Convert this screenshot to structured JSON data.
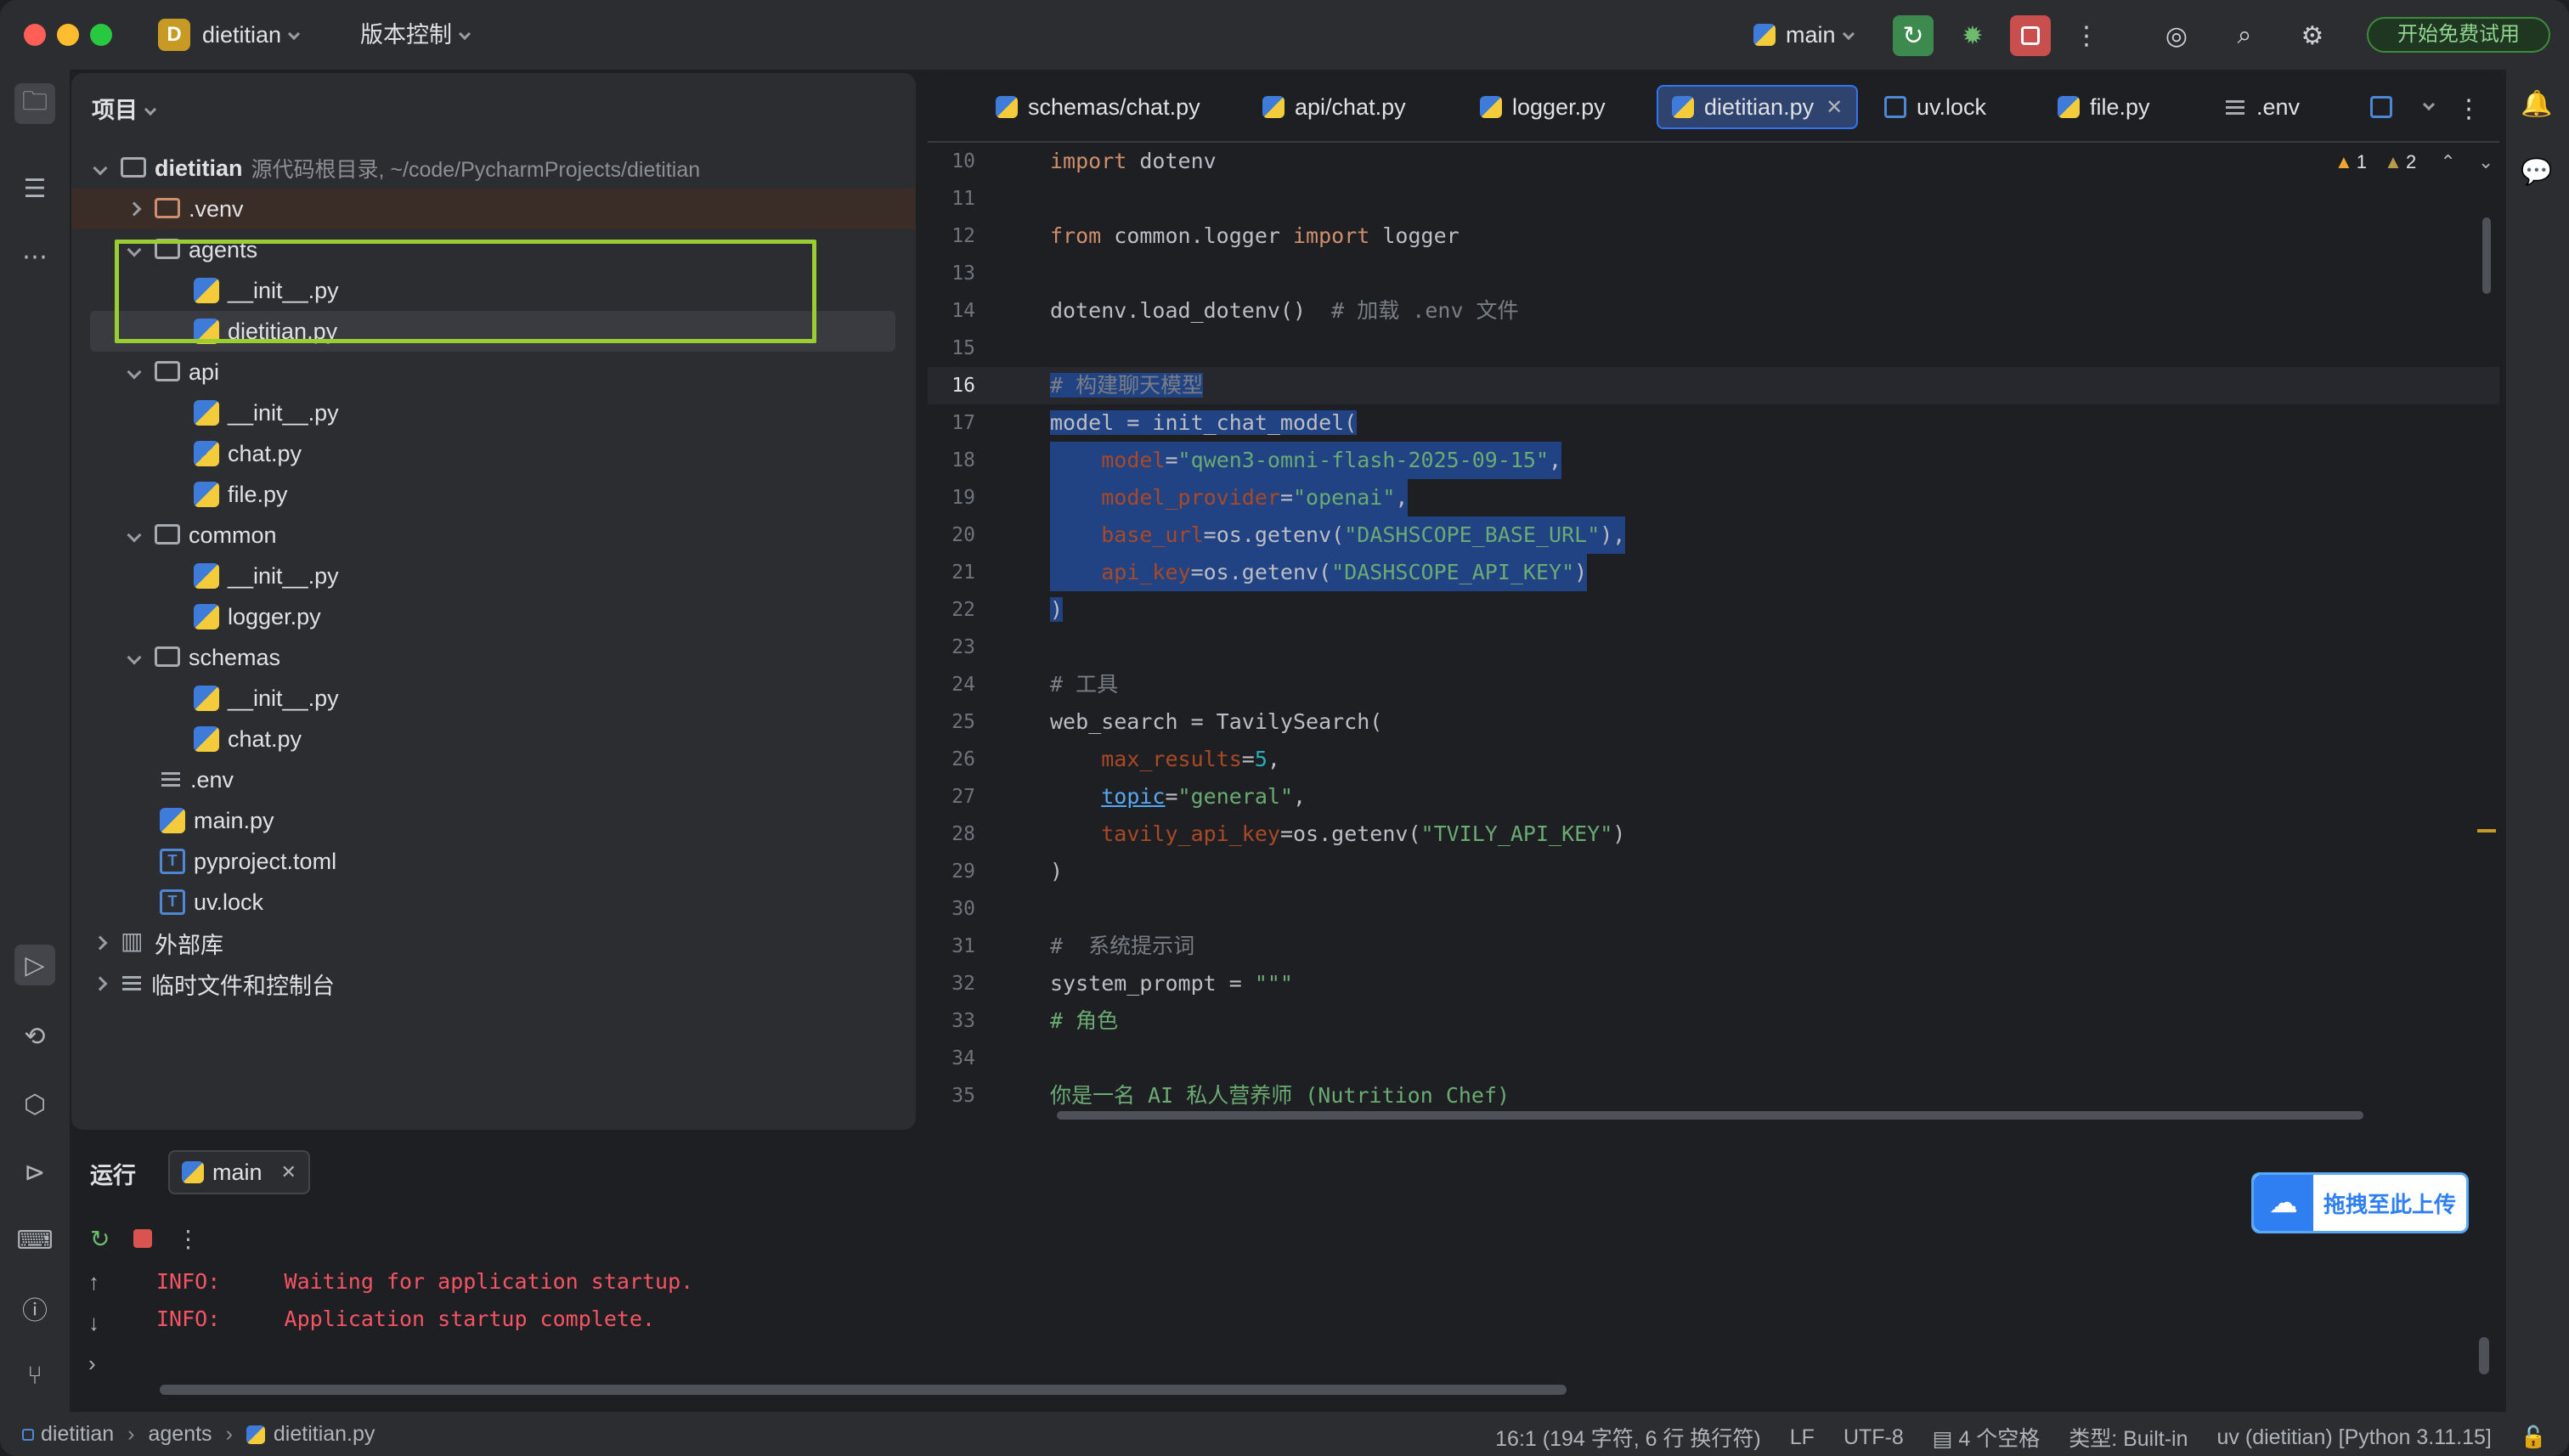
{
  "titlebar": {
    "project_initial": "D",
    "project_name": "dietitian",
    "vcs_label": "版本控制",
    "branch": "main",
    "trial_button": "开始免费试用"
  },
  "project_panel": {
    "title": "项目",
    "root": {
      "name": "dietitian",
      "hint": "源代码根目录, ~/code/PycharmProjects/dietitian"
    },
    "tree": [
      {
        "label": ".venv"
      },
      {
        "label": "agents"
      },
      {
        "label": "__init__.py"
      },
      {
        "label": "dietitian.py"
      },
      {
        "label": "api"
      },
      {
        "label": "__init__.py"
      },
      {
        "label": "chat.py"
      },
      {
        "label": "file.py"
      },
      {
        "label": "common"
      },
      {
        "label": "__init__.py"
      },
      {
        "label": "logger.py"
      },
      {
        "label": "schemas"
      },
      {
        "label": "__init__.py"
      },
      {
        "label": "chat.py"
      },
      {
        "label": ".env"
      },
      {
        "label": "main.py"
      },
      {
        "label": "pyproject.toml"
      },
      {
        "label": "uv.lock"
      },
      {
        "label": "外部库"
      },
      {
        "label": "临时文件和控制台"
      }
    ]
  },
  "editor": {
    "tabs": [
      {
        "label": "schemas/chat.py"
      },
      {
        "label": "api/chat.py"
      },
      {
        "label": "logger.py"
      },
      {
        "label": "dietitian.py"
      },
      {
        "label": "uv.lock"
      },
      {
        "label": "file.py"
      },
      {
        "label": ".env"
      }
    ],
    "warnings": "1",
    "weak_warnings": "2",
    "line_numbers": [
      "10",
      "11",
      "12",
      "13",
      "14",
      "15",
      "16",
      "17",
      "18",
      "19",
      "20",
      "21",
      "22",
      "23",
      "24",
      "25",
      "26",
      "27",
      "28",
      "29",
      "30",
      "31",
      "32",
      "33",
      "34",
      "35"
    ],
    "code": {
      "l10_kw": "import",
      "l10_rest": " dotenv",
      "l12_kw1": "from",
      "l12_mid": " common.logger ",
      "l12_kw2": "import",
      "l12_rest": " logger",
      "l14_code": "dotenv.load_dotenv()  ",
      "l14_com": "# 加载 .env 文件",
      "l16_com": "# 构建聊天模型",
      "l17_code": "model = init_chat_model(",
      "l18_param": "model",
      "l18_eq": "=",
      "l18_str": "\"qwen3-omni-flash-2025-09-15\"",
      "l18_end": ",",
      "l19_param": "model_provider",
      "l19_eq": "=",
      "l19_str": "\"openai\"",
      "l19_end": ",",
      "l20_param": "base_url",
      "l20_mid": "=os.getenv(",
      "l20_str": "\"DASHSCOPE_BASE_URL\"",
      "l20_end": "),",
      "l21_param": "api_key",
      "l21_mid": "=os.getenv(",
      "l21_str": "\"DASHSCOPE_API_KEY\"",
      "l21_end": ")",
      "l22_code": ")",
      "l24_com": "# 工具",
      "l25_code": "web_search = TavilySearch(",
      "l26_param": "max_results",
      "l26_eq": "=",
      "l26_num": "5",
      "l26_end": ",",
      "l27_param": "topic",
      "l27_eq": "=",
      "l27_str": "\"general\"",
      "l27_end": ",",
      "l28_param": "tavily_api_key",
      "l28_mid": "=os.getenv(",
      "l28_str": "\"TVILY_API_KEY\"",
      "l28_end": ")",
      "l29_code": ")",
      "l31_com": "#  系统提示词",
      "l32_code": "system_prompt = ",
      "l32_str": "\"\"\"",
      "l33_str": "# 角色",
      "l35_str": "你是一名 AI 私人营养师 (Nutrition Chef)"
    }
  },
  "run_panel": {
    "title": "运行",
    "tab_label": "main",
    "console_lines": [
      {
        "level": "INFO:",
        "message": "Waiting for application startup."
      },
      {
        "level": "INFO:",
        "message": "Application startup complete."
      }
    ],
    "upload_button": "拖拽至此上传"
  },
  "statusbar": {
    "breadcrumb": [
      "dietitian",
      "agents",
      "dietitian.py"
    ],
    "position": "16:1 (194 字符, 6 行 换行符)",
    "line_sep": "LF",
    "encoding": "UTF-8",
    "indent": "4 个空格",
    "file_type": "类型: Built-in",
    "interpreter": "uv (dietitian) [Python 3.11.15]"
  },
  "colors": {
    "accent": "#3574f0",
    "selection": "#214283",
    "highlight_box": "#9acd32",
    "error_text": "#f75464"
  }
}
